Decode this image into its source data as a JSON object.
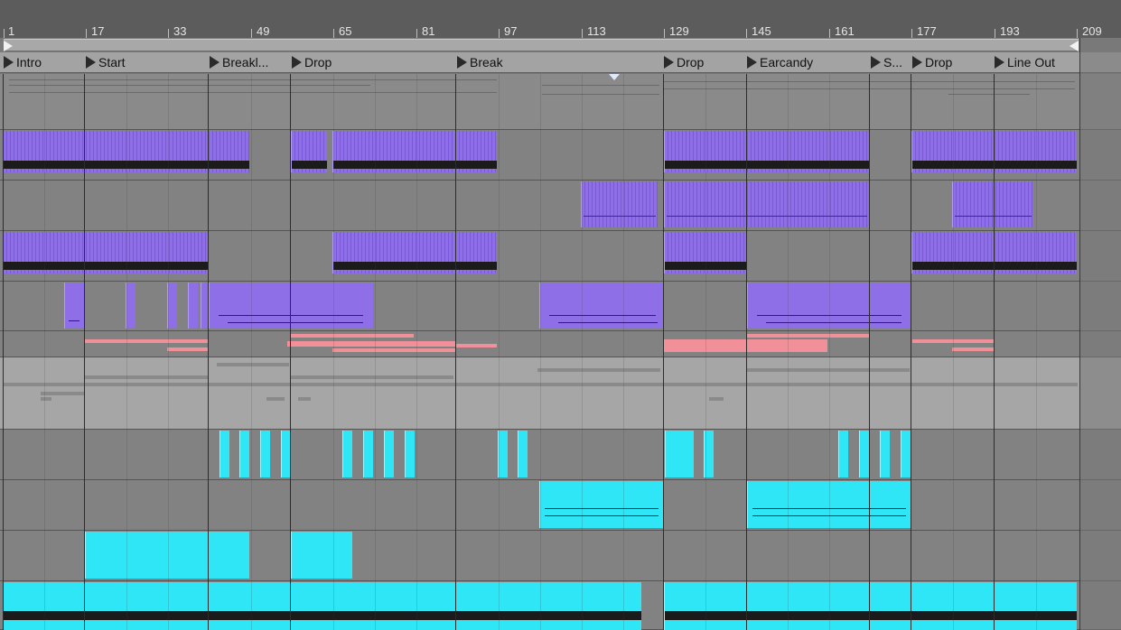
{
  "ruler": {
    "bars": [
      "1",
      "17",
      "33",
      "49",
      "65",
      "81",
      "97",
      "113",
      "129",
      "145",
      "161",
      "177",
      "193",
      "209"
    ]
  },
  "locators": [
    {
      "label": "Intro"
    },
    {
      "label": "Start"
    },
    {
      "label": "Breakl..."
    },
    {
      "label": "Drop"
    },
    {
      "label": "Break"
    },
    {
      "label": "Drop"
    },
    {
      "label": "Earcandy"
    },
    {
      "label": "S..."
    },
    {
      "label": "Drop"
    },
    {
      "label": "Line Out"
    }
  ],
  "colors": {
    "purple": "#8f6fe8",
    "cyan": "#2ee6f6",
    "pink": "#f2909a",
    "background": "#828282",
    "ruler": "#5c5c5c"
  },
  "icons": {
    "loop_start": "triangle-right-icon",
    "loop_end": "triangle-left-icon",
    "locator": "triangle-right-icon",
    "playhead": "triangle-down-icon"
  }
}
